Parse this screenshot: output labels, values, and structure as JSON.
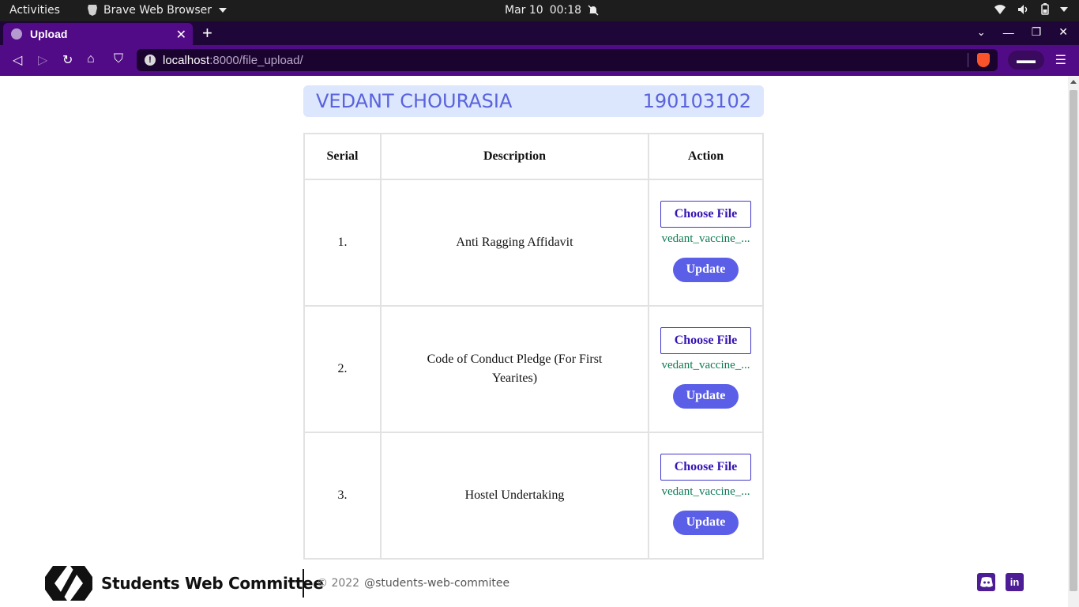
{
  "os_bar": {
    "activities": "Activities",
    "app_name": "Brave Web Browser",
    "date": "Mar 10",
    "time": "00:18"
  },
  "browser": {
    "tab_title": "Upload",
    "url_host": "localhost",
    "url_path": ":8000/file_upload/"
  },
  "student": {
    "name": "VEDANT CHOURASIA",
    "roll": "190103102"
  },
  "table": {
    "headers": [
      "Serial",
      "Description",
      "Action"
    ],
    "rows": [
      {
        "serial": "1.",
        "description": "Anti Ragging Affidavit",
        "choose_label": "Choose File",
        "file_name": "vedant_vaccine_...",
        "update_label": "Update"
      },
      {
        "serial": "2.",
        "description": "Code of Conduct Pledge (For First Yearites)",
        "choose_label": "Choose File",
        "file_name": "vedant_vaccine_...",
        "update_label": "Update"
      },
      {
        "serial": "3.",
        "description": "Hostel Undertaking",
        "choose_label": "Choose File",
        "file_name": "vedant_vaccine_...",
        "update_label": "Update"
      }
    ]
  },
  "footer": {
    "brand": "Students Web Committee",
    "copyright": "© 2022",
    "handle": "@students-web-commitee"
  },
  "icons": {
    "discord": "discord-icon",
    "linkedin": "linkedin-icon"
  },
  "colors": {
    "accent": "#5b5fe8",
    "header_bg": "#dce6fd",
    "file_name": "#0d7a52",
    "browser_purple": "#520b86"
  }
}
